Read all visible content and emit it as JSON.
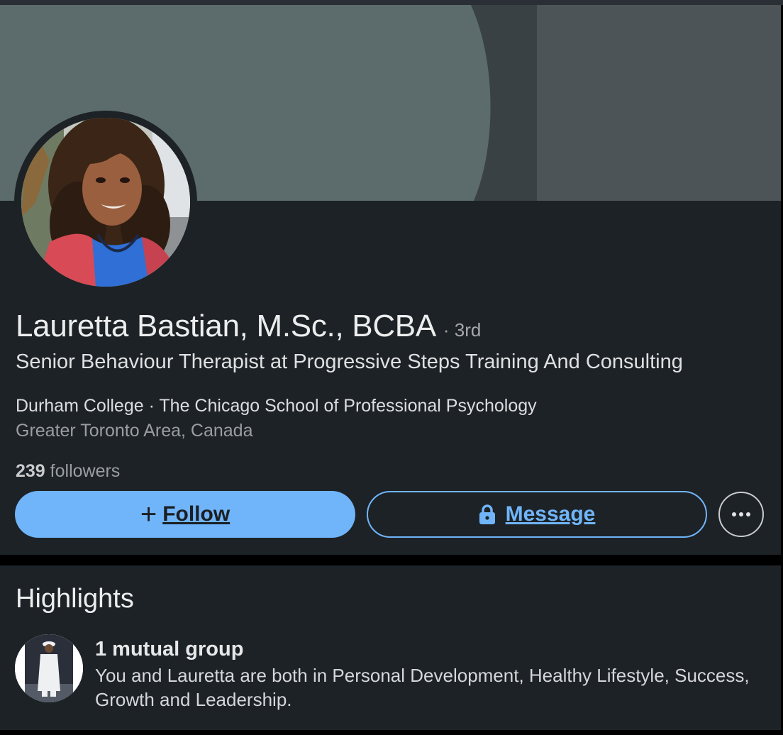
{
  "profile": {
    "name": "Lauretta Bastian, M.Sc., BCBA",
    "degree": "· 3rd",
    "headline": "Senior Behaviour Therapist at Progressive Steps Training And Consulting",
    "education": "Durham College · The Chicago School of Professional Psychology",
    "location": "Greater Toronto Area, Canada",
    "followers_count": "239",
    "followers_label": " followers"
  },
  "actions": {
    "follow_plus": "+",
    "follow_label": "Follow",
    "message_label": "Message",
    "more_icon": "ellipsis-icon"
  },
  "highlights": {
    "title": "Highlights",
    "items": [
      {
        "heading": "1 mutual group",
        "description": "You and Lauretta are both in Personal Development, Healthy Lifestyle, Success, Growth and Leadership."
      }
    ]
  },
  "colors": {
    "background": "#000000",
    "card": "#1d2226",
    "cover": "#4c5558",
    "accent": "#70b5f9",
    "text_primary": "#eceded",
    "text_secondary": "#9b9ea1"
  }
}
